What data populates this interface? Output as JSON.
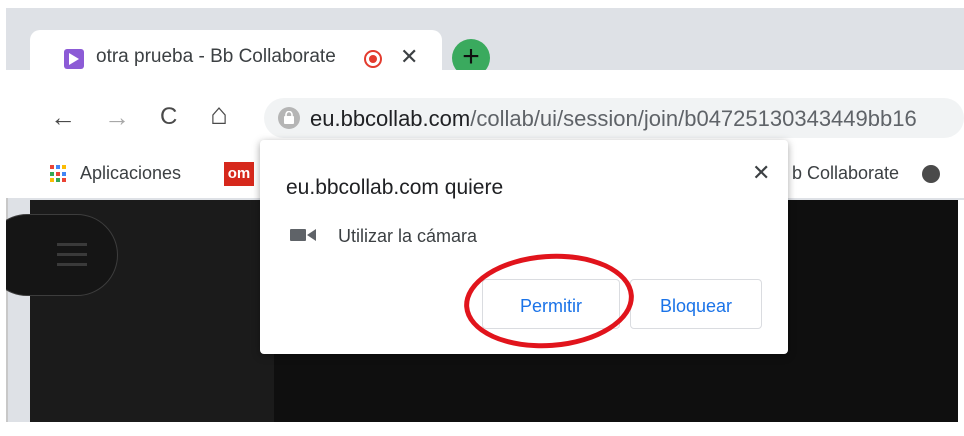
{
  "browser": {
    "tab": {
      "title": "otra prueba - Bb Collaborate",
      "close_glyph": "✕",
      "favicon": "bb-collaborate-icon",
      "recording_icon": "recording-icon"
    },
    "new_tab_glyph": "+",
    "toolbar": {
      "back_glyph": "←",
      "forward_glyph": "→",
      "reload_glyph": "C",
      "home_glyph": "⌂",
      "url_host": "eu.bbcollab.com",
      "url_path": "/collab/ui/session/join/b04725130343449bb16"
    },
    "bookmarks": {
      "apps_label": "Aplicaciones",
      "om_badge": "om",
      "truncated_label": "b Collaborate"
    }
  },
  "popup": {
    "title": "eu.bbcollab.com quiere",
    "close_glyph": "✕",
    "permission_label": "Utilizar la cámara",
    "allow_label": "Permitir",
    "block_label": "Bloquear"
  },
  "colors": {
    "accent_button_text": "#1a73e8",
    "annotation_circle": "#e1141c",
    "new_tab_green": "#3aaa5e",
    "recording_red": "#e33b2e"
  }
}
